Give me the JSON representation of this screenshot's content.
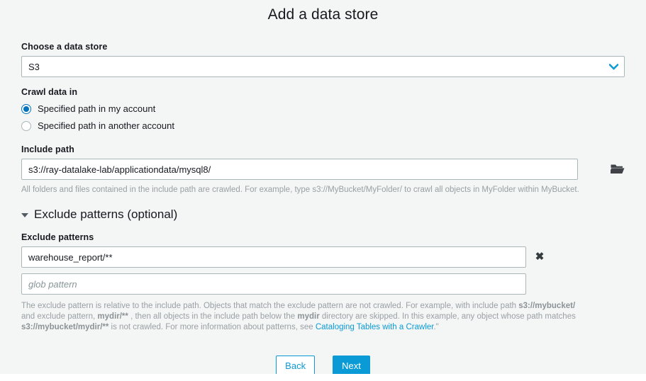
{
  "page": {
    "title": "Add a data store"
  },
  "data_store": {
    "label": "Choose a data store",
    "selected": "S3",
    "chevron_icon": "chevron-down-icon",
    "accent_color": "#0a9bd6"
  },
  "crawl_data_in": {
    "label": "Crawl data in",
    "options": [
      {
        "label": "Specified path in my account",
        "selected": true
      },
      {
        "label": "Specified path in another account",
        "selected": false
      }
    ]
  },
  "include_path": {
    "label": "Include path",
    "value": "s3://ray-datalake-lab/applicationdata/mysql8/",
    "placeholder": "",
    "browse_icon": "folder-open-icon",
    "help": "All folders and files contained in the include path are crawled. For example, type s3://MyBucket/MyFolder/ to crawl all objects in MyFolder within MyBucket."
  },
  "exclude_section": {
    "toggle_label": "Exclude patterns (optional)",
    "expanded": true,
    "caret_icon": "caret-down-icon",
    "field_label": "Exclude patterns",
    "rows": [
      {
        "value": "warehouse_report/**",
        "placeholder": "glob pattern",
        "remove_icon": "close-icon",
        "has_remove": true
      },
      {
        "value": "",
        "placeholder": "glob pattern",
        "remove_icon": "close-icon",
        "has_remove": false
      }
    ],
    "help": {
      "part1": "The exclude pattern is relative to the include path. Objects that match the exclude pattern are not crawled. For example, with include path ",
      "bold1": "s3://mybucket/",
      "part2": " and exclude pattern, ",
      "bold2": "mydir/**",
      "part3": " , then all objects in the include path below the ",
      "bold3": "mydir",
      "part4": " directory are skipped. In this example, any object whose path matches ",
      "bold4": "s3://mybucket/mydir/**",
      "part5": " is not crawled. For more information about patterns, see ",
      "link": "Cataloging Tables with a Crawler",
      "part6": ".\""
    }
  },
  "footer": {
    "back_label": "Back",
    "next_label": "Next"
  }
}
